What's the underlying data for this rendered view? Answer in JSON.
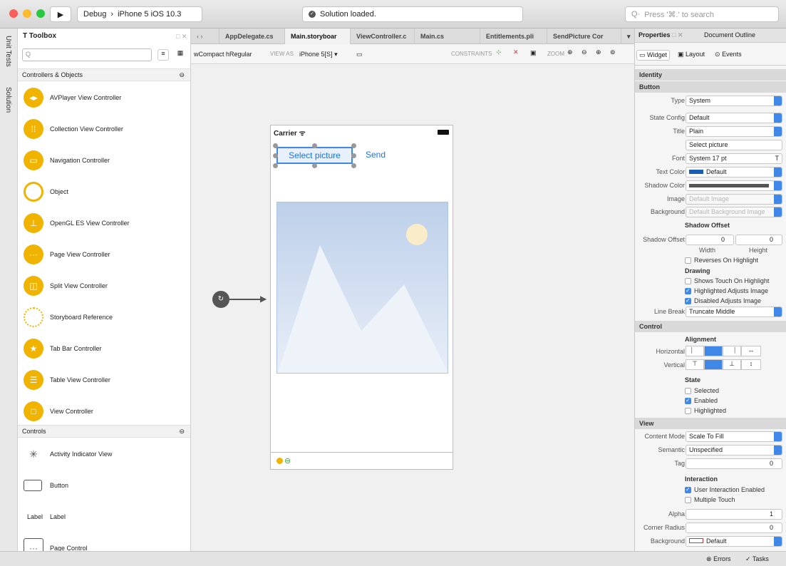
{
  "titlebar": {
    "run_icon": "play-icon",
    "scheme_config": "Debug",
    "scheme_sep": "›",
    "device": "iPhone 5 iOS 10.3",
    "status": "Solution loaded.",
    "search_placeholder": "Press '⌘.' to search"
  },
  "leftstrip": {
    "unit_tests": "Unit Tests",
    "solution": "Solution"
  },
  "toolbox": {
    "title": "Toolbox",
    "search_placeholder": "",
    "sections": [
      {
        "title": "Controllers & Objects"
      },
      {
        "title": "Controls"
      }
    ],
    "controllers": [
      {
        "label": "AVPlayer View Controller",
        "icon": "avplayer-icon"
      },
      {
        "label": "Collection View Controller",
        "icon": "collection-icon"
      },
      {
        "label": "Navigation Controller",
        "icon": "navigation-icon"
      },
      {
        "label": "Object",
        "icon": "object-icon"
      },
      {
        "label": "OpenGL ES View Controller",
        "icon": "opengl-icon"
      },
      {
        "label": "Page View Controller",
        "icon": "page-icon"
      },
      {
        "label": "Split View Controller",
        "icon": "split-icon"
      },
      {
        "label": "Storyboard Reference",
        "icon": "storyboard-reference-icon"
      },
      {
        "label": "Tab Bar Controller",
        "icon": "tabbar-icon"
      },
      {
        "label": "Table View Controller",
        "icon": "table-icon"
      },
      {
        "label": "View Controller",
        "icon": "view-controller-icon"
      }
    ],
    "controls": [
      {
        "label": "Activity Indicator View",
        "icon": "activity-indicator-icon"
      },
      {
        "label": "Button",
        "icon": "button-icon"
      },
      {
        "label": "Label",
        "icon_text": "Label"
      },
      {
        "label": "Page Control",
        "icon": "page-control-icon"
      }
    ]
  },
  "tabs": [
    "AppDelegate.cs",
    "Main.storyboar",
    "ViewController.c",
    "Main.cs",
    "Entitlements.pli",
    "SendPicture Cor"
  ],
  "designbar": {
    "size_class": "wCompact hRegular",
    "view_as_label": "VIEW AS",
    "view_as_value": "iPhone 5[S]",
    "constraints_label": "CONSTRAINTS",
    "zoom_label": "ZOOM"
  },
  "phone": {
    "carrier": "Carrier",
    "select_button": "Select picture",
    "send_button": "Send"
  },
  "props": {
    "tabs": [
      "Properties",
      "Document Outline"
    ],
    "subtabs": [
      "Widget",
      "Layout",
      "Events"
    ],
    "identity": "Identity",
    "button_head": "Button",
    "type_label": "Type",
    "type_value": "System",
    "state_label": "State Config",
    "state_value": "Default",
    "title_label": "Title",
    "title_value": "Plain",
    "title_text": "Select picture",
    "font_label": "Font",
    "font_value": "System 17 pt",
    "textcolor_label": "Text Color",
    "textcolor_value": "Default",
    "shadowcolor_label": "Shadow Color",
    "image_label": "Image",
    "image_value": "Default Image",
    "background_label": "Background",
    "background_value": "Default Background Image",
    "shadow_offset_head": "Shadow Offset",
    "shadow_offset_label": "Shadow Offset",
    "width_value": "0",
    "height_value": "0",
    "width_label": "Width",
    "height_label": "Height",
    "reverses": "Reverses On Highlight",
    "drawing_head": "Drawing",
    "shows_touch": "Shows Touch On Highlight",
    "highlighted_adjusts": "Highlighted Adjusts Image",
    "disabled_adjusts": "Disabled Adjusts Image",
    "linebreak_label": "Line Break",
    "linebreak_value": "Truncate Middle",
    "control_head": "Control",
    "alignment_head": "Alignment",
    "horizontal_label": "Horizontal",
    "vertical_label": "Vertical",
    "state_head": "State",
    "selected": "Selected",
    "enabled": "Enabled",
    "highlighted": "Highlighted",
    "view_head": "View",
    "contentmode_label": "Content Mode",
    "contentmode_value": "Scale To Fill",
    "semantic_label": "Semantic",
    "semantic_value": "Unspecified",
    "tag_label": "Tag",
    "tag_value": "0",
    "interaction_head": "Interaction",
    "user_interaction": "User Interaction Enabled",
    "multiple_touch": "Multiple Touch",
    "alpha_label": "Alpha",
    "alpha_value": "1",
    "corner_label": "Corner Radius",
    "corner_value": "0",
    "bg_label": "Background",
    "bg_value": "Default"
  },
  "statusbar": {
    "errors": "Errors",
    "tasks": "Tasks"
  },
  "colors": {
    "accent": "#3f88e8",
    "toolbox_icon": "#f0b400",
    "image_placeholder": "#bdd0ea"
  }
}
